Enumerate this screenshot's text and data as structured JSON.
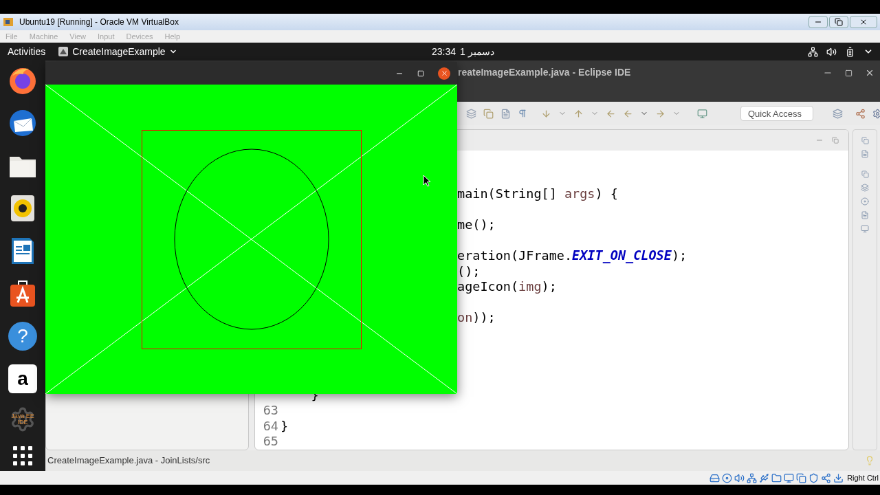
{
  "vbox": {
    "title": "Ubuntu19 [Running] - Oracle VM VirtualBox",
    "menu": [
      {
        "label": "File",
        "disabled": true
      },
      {
        "label": "Machine",
        "disabled": true
      },
      {
        "label": "View",
        "disabled": true
      },
      {
        "label": "Input",
        "disabled": true
      },
      {
        "label": "Devices",
        "disabled": true
      },
      {
        "label": "Help",
        "disabled": true
      }
    ],
    "host_key": "Right Ctrl"
  },
  "gnome": {
    "activities": "Activities",
    "app_menu": "CreateImageExample",
    "time": "23:34",
    "date": "1 دسمبر"
  },
  "dock": [
    {
      "kind": "browser"
    },
    {
      "kind": "mail"
    },
    {
      "kind": "folder"
    },
    {
      "kind": "speaker"
    },
    {
      "kind": "document"
    },
    {
      "kind": "store"
    },
    {
      "kind": "help",
      "glyph": "?"
    },
    {
      "kind": "shop",
      "glyph": "a"
    },
    {
      "kind": "gear",
      "glyph": "Java EE IDE"
    },
    {
      "kind": "grid"
    }
  ],
  "eclipse": {
    "title": "reateImageExample.java - Eclipse IDE",
    "quick_access": {
      "placeholder": "Quick Access"
    },
    "status": "CreateImageExample.java - JoinLists/src",
    "lines": [
      {
        "segments": [
          {
            "kind": "plain",
            "text": "main(String[] "
          },
          {
            "kind": "local",
            "text": "args"
          },
          {
            "kind": "plain",
            "text": ") {"
          }
        ]
      },
      {
        "blank": true
      },
      {
        "segments": [
          {
            "kind": "plain",
            "text": "me();"
          }
        ]
      },
      {
        "blank": true
      },
      {
        "segments": [
          {
            "kind": "plain",
            "text": "eration(JFrame."
          },
          {
            "kind": "constant",
            "text": "EXIT_ON_CLOSE"
          },
          {
            "kind": "plain",
            "text": ");"
          }
        ]
      },
      {
        "segments": [
          {
            "kind": "plain",
            "text": "();"
          }
        ]
      },
      {
        "segments": [
          {
            "kind": "plain",
            "text": "ageIcon("
          },
          {
            "kind": "local",
            "text": "img"
          },
          {
            "kind": "plain",
            "text": ");"
          }
        ]
      },
      {
        "blank": true
      },
      {
        "segments": [
          {
            "kind": "local",
            "text": "on"
          },
          {
            "kind": "plain",
            "text": "));"
          }
        ]
      },
      {
        "blank": true
      },
      {
        "blank": true
      },
      {
        "blank": true
      },
      {
        "blank": true
      },
      {
        "segments": [
          {
            "kind": "plain",
            "text": "    }"
          }
        ],
        "number_hidden": true
      },
      {
        "number": "63"
      },
      {
        "number": "64",
        "segments": [
          {
            "kind": "plain",
            "text": "}"
          }
        ]
      },
      {
        "number": "65"
      }
    ]
  }
}
